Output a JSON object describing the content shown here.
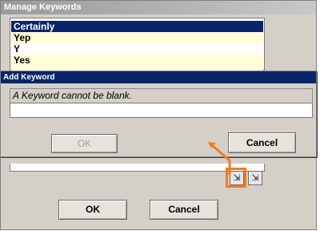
{
  "manage_dialog": {
    "title": "Manage Keywords",
    "keywords": [
      "Certainly",
      "Yep",
      "Y",
      "Yes",
      ""
    ],
    "ok_label": "OK",
    "cancel_label": "Cancel",
    "add_icon": "add-keyword-icon",
    "remove_icon": "remove-keyword-icon",
    "add_glyph": "⇲",
    "remove_glyph": "⇲"
  },
  "add_dialog": {
    "title": "Add Keyword",
    "message": "A Keyword cannot be blank.",
    "input_value": "",
    "ok_label": "OK",
    "cancel_label": "Cancel"
  },
  "colors": {
    "highlight": "#f07d1e",
    "selection": "#0a246a",
    "alt_row": "#ffffd8"
  }
}
